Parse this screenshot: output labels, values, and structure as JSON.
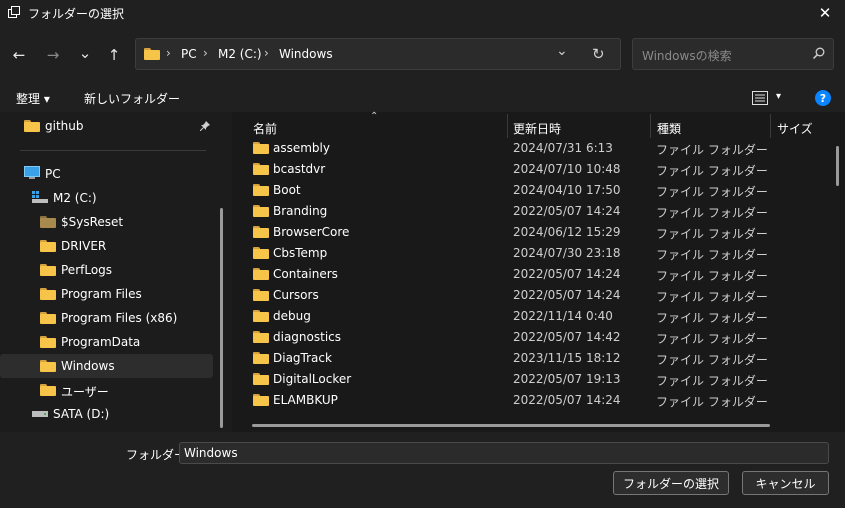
{
  "window": {
    "title": "フォルダーの選択",
    "close_glyph": "✕"
  },
  "nav": {
    "back": "←",
    "forward": "→",
    "recent": "⌄",
    "up": "↑",
    "breadcrumb": [
      "PC",
      "M2 (C:)",
      "Windows"
    ],
    "sep": "›",
    "dropdown": "⌄",
    "refresh": "↻",
    "search_placeholder": "Windowsの検索"
  },
  "commands": {
    "organize": "整理 ▾",
    "new_folder": "新しいフォルダー",
    "view_arrow": "▾",
    "help": "?"
  },
  "tree": [
    {
      "label": "github",
      "pinned": true
    },
    {
      "label": "PC"
    },
    {
      "label": "M2 (C:)"
    },
    {
      "label": "$SysReset"
    },
    {
      "label": "DRIVER"
    },
    {
      "label": "PerfLogs"
    },
    {
      "label": "Program Files"
    },
    {
      "label": "Program Files (x86)"
    },
    {
      "label": "ProgramData"
    },
    {
      "label": "Windows",
      "selected": true
    },
    {
      "label": "ユーザー"
    },
    {
      "label": "SATA (D:)"
    }
  ],
  "columns": {
    "name": "名前",
    "date": "更新日時",
    "type": "種類",
    "size": "サイズ",
    "sort_arrow": "⌃"
  },
  "rows": [
    {
      "name": "assembly",
      "date": "2024/07/31 6:13",
      "type": "ファイル フォルダー"
    },
    {
      "name": "bcastdvr",
      "date": "2024/07/10 10:48",
      "type": "ファイル フォルダー"
    },
    {
      "name": "Boot",
      "date": "2024/04/10 17:50",
      "type": "ファイル フォルダー"
    },
    {
      "name": "Branding",
      "date": "2022/05/07 14:24",
      "type": "ファイル フォルダー"
    },
    {
      "name": "BrowserCore",
      "date": "2024/06/12 15:29",
      "type": "ファイル フォルダー"
    },
    {
      "name": "CbsTemp",
      "date": "2024/07/30 23:18",
      "type": "ファイル フォルダー"
    },
    {
      "name": "Containers",
      "date": "2022/05/07 14:24",
      "type": "ファイル フォルダー"
    },
    {
      "name": "Cursors",
      "date": "2022/05/07 14:24",
      "type": "ファイル フォルダー"
    },
    {
      "name": "debug",
      "date": "2022/11/14 0:40",
      "type": "ファイル フォルダー"
    },
    {
      "name": "diagnostics",
      "date": "2022/05/07 14:42",
      "type": "ファイル フォルダー"
    },
    {
      "name": "DiagTrack",
      "date": "2023/11/15 18:12",
      "type": "ファイル フォルダー"
    },
    {
      "name": "DigitalLocker",
      "date": "2022/05/07 19:13",
      "type": "ファイル フォルダー"
    },
    {
      "name": "ELAMBKUP",
      "date": "2022/05/07 14:24",
      "type": "ファイル フォルダー"
    }
  ],
  "footer": {
    "folder_label": "フォルダー:",
    "folder_value": "Windows",
    "select_button": "フォルダーの選択",
    "cancel_button": "キャンセル"
  },
  "colors": {
    "bg": "#1c1c1c",
    "chrome": "#202020",
    "folder": "#f5c448",
    "accent_help": "#0a84ff"
  }
}
